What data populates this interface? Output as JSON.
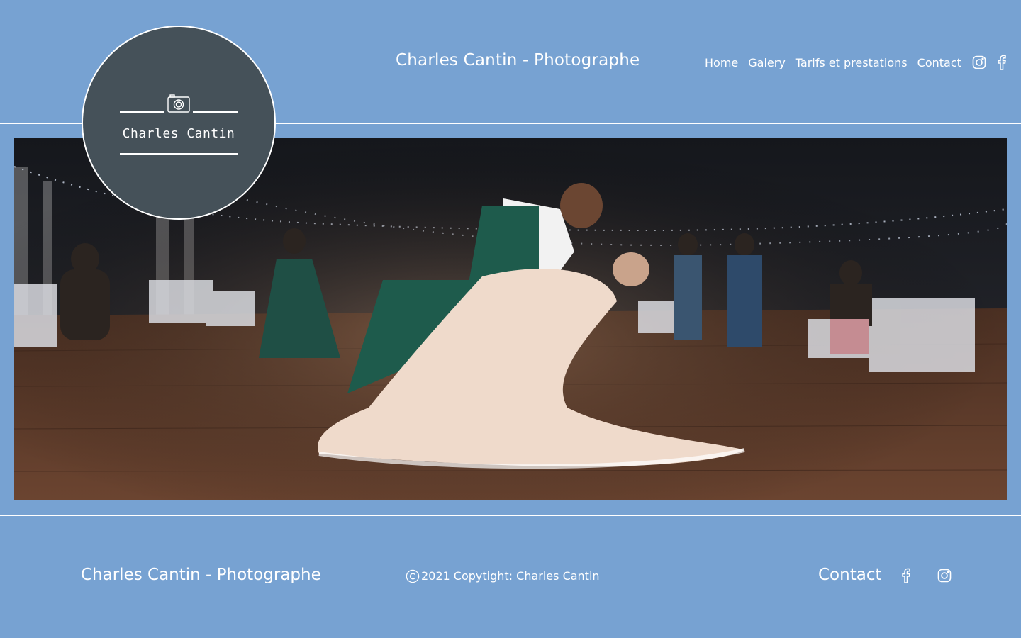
{
  "header": {
    "site_title": "Charles Cantin - Photographe",
    "nav": [
      {
        "label": "Home"
      },
      {
        "label": "Galery"
      },
      {
        "label": "Tarifs et prestations"
      },
      {
        "label": "Contact"
      }
    ],
    "social_icons": [
      "instagram-icon",
      "facebook-icon"
    ]
  },
  "logo": {
    "text": "Charles Cantin",
    "icon": "camera-icon"
  },
  "footer": {
    "title": "Charles Cantin - Photographe",
    "copyright": "2021 Copytight: Charles Cantin",
    "contact_label": "Contact",
    "social_icons": [
      "facebook-icon",
      "instagram-icon"
    ]
  },
  "colors": {
    "background": "#77a2d2",
    "logo_circle": "#455159",
    "text": "#ffffff"
  }
}
